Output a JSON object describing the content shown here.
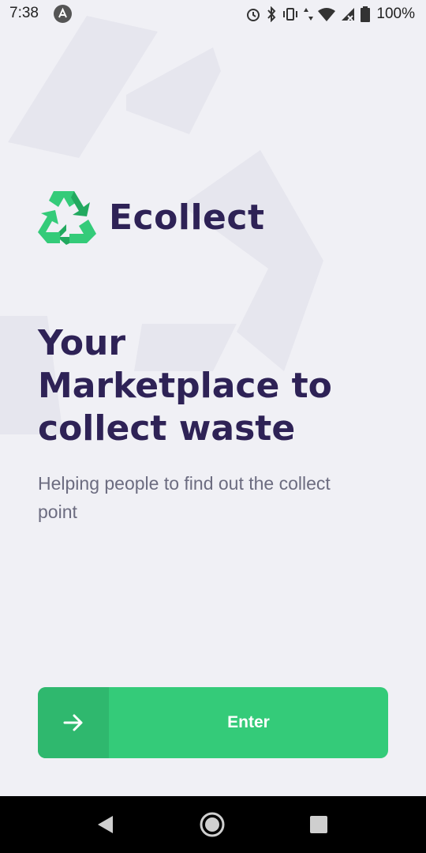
{
  "status_bar": {
    "time": "7:38",
    "battery": "100%"
  },
  "app": {
    "name": "Ecollect",
    "brand_color": "#34cb79",
    "text_color": "#2e2256"
  },
  "hero": {
    "headline_lines": [
      "Your",
      "Marketplace to",
      "collect waste"
    ],
    "subtitle": "Helping people to find out the collect point"
  },
  "enter_button": {
    "label": "Enter",
    "icon": "arrow-right-icon"
  },
  "nav_bar": {
    "back_icon": "back-icon",
    "home_icon": "home-icon",
    "recents_icon": "recents-icon"
  }
}
